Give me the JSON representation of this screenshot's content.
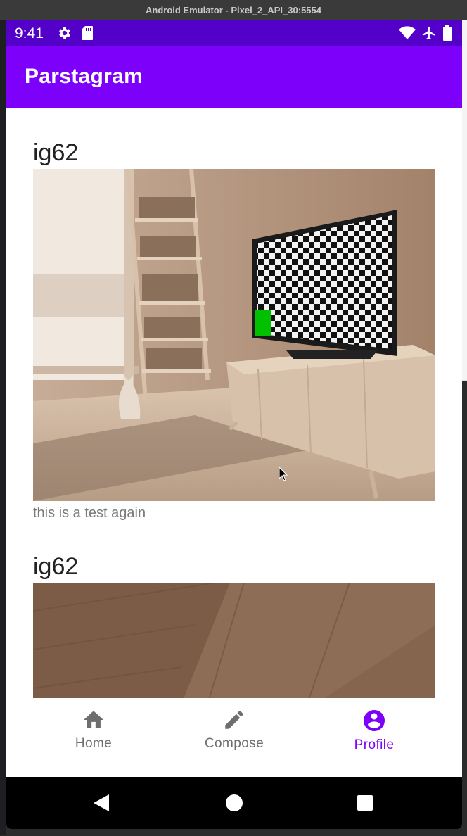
{
  "window": {
    "title": "Android Emulator - Pixel_2_API_30:5554"
  },
  "status_bar": {
    "time": "9:41",
    "left_icons": [
      "gear-icon",
      "sd-card-icon"
    ],
    "right_icons": [
      "wifi-icon",
      "airplane-icon",
      "battery-icon"
    ]
  },
  "app_bar": {
    "title": "Parstagram",
    "color": "#7c00fa",
    "status_color": "#5300c9"
  },
  "posts": [
    {
      "username": "ig62",
      "caption": "this is a test again",
      "image": "living-room-photo"
    },
    {
      "username": "ig62",
      "caption": "",
      "image": "wood-floor-photo"
    }
  ],
  "bottom_nav": {
    "items": [
      {
        "label": "Home",
        "icon": "home-icon",
        "active": false
      },
      {
        "label": "Compose",
        "icon": "pencil-icon",
        "active": false
      },
      {
        "label": "Profile",
        "icon": "account-circle-icon",
        "active": true
      }
    ],
    "active_color": "#7c00fa",
    "inactive_color": "#6e6e6e"
  },
  "system_nav": {
    "buttons": [
      "back-icon",
      "home-circle-icon",
      "recents-icon"
    ]
  }
}
